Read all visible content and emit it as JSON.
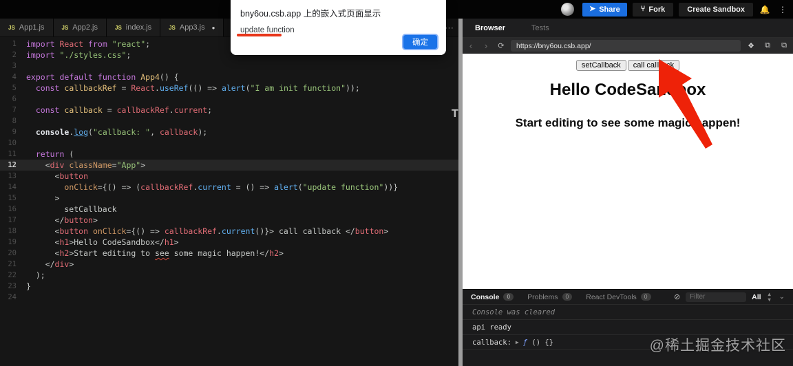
{
  "topbar": {
    "share_label": "Share",
    "fork_label": "Fork",
    "create_sandbox_label": "Create Sandbox"
  },
  "dialog": {
    "title": "bny6ou.csb.app 上的嵌入式页面显示",
    "message": "update function",
    "ok_label": "确定"
  },
  "editor": {
    "js_badge": "JS",
    "overflow_menu": "⋯",
    "tabs": [
      {
        "label": "App1.js",
        "dirty": false
      },
      {
        "label": "App2.js",
        "dirty": false
      },
      {
        "label": "index.js",
        "dirty": false
      },
      {
        "label": "App3.js",
        "dirty": true
      }
    ],
    "dirty_dot": "●",
    "lines": [
      {
        "n": 1,
        "hl": false,
        "tokens": [
          [
            "kw",
            "import"
          ],
          [
            "plain",
            " "
          ],
          [
            "ref",
            "React"
          ],
          [
            "plain",
            " "
          ],
          [
            "kw",
            "from"
          ],
          [
            "plain",
            " "
          ],
          [
            "str",
            "\"react\""
          ],
          [
            "plain",
            ";"
          ]
        ]
      },
      {
        "n": 2,
        "hl": false,
        "tokens": [
          [
            "kw",
            "import"
          ],
          [
            "plain",
            " "
          ],
          [
            "str",
            "\"./styles.css\""
          ],
          [
            "plain",
            ";"
          ]
        ]
      },
      {
        "n": 3,
        "hl": false,
        "tokens": []
      },
      {
        "n": 4,
        "hl": false,
        "tokens": [
          [
            "kw",
            "export"
          ],
          [
            "plain",
            " "
          ],
          [
            "kw",
            "default"
          ],
          [
            "plain",
            " "
          ],
          [
            "kw",
            "function"
          ],
          [
            "plain",
            " "
          ],
          [
            "def",
            "App4"
          ],
          [
            "plain",
            "() {"
          ]
        ]
      },
      {
        "n": 5,
        "hl": false,
        "tokens": [
          [
            "plain",
            "  "
          ],
          [
            "kw",
            "const"
          ],
          [
            "plain",
            " "
          ],
          [
            "def",
            "callbackRef"
          ],
          [
            "plain",
            " = "
          ],
          [
            "ref",
            "React"
          ],
          [
            "plain",
            "."
          ],
          [
            "fn",
            "useRef"
          ],
          [
            "plain",
            "(() => "
          ],
          [
            "fn",
            "alert"
          ],
          [
            "plain",
            "("
          ],
          [
            "str",
            "\"I am init function\""
          ],
          [
            "plain",
            "));"
          ]
        ]
      },
      {
        "n": 6,
        "hl": false,
        "tokens": []
      },
      {
        "n": 7,
        "hl": false,
        "tokens": [
          [
            "plain",
            "  "
          ],
          [
            "kw",
            "const"
          ],
          [
            "plain",
            " "
          ],
          [
            "def",
            "callback"
          ],
          [
            "plain",
            " = "
          ],
          [
            "ref",
            "callbackRef"
          ],
          [
            "plain",
            "."
          ],
          [
            "ref",
            "current"
          ],
          [
            "plain",
            ";"
          ]
        ]
      },
      {
        "n": 8,
        "hl": false,
        "tokens": []
      },
      {
        "n": 9,
        "hl": false,
        "tokens": [
          [
            "plain",
            "  "
          ],
          [
            "bold",
            "console"
          ],
          [
            "plain",
            "."
          ],
          [
            "fnu",
            "log"
          ],
          [
            "plain",
            "("
          ],
          [
            "str",
            "\"callback: \""
          ],
          [
            "plain",
            ", "
          ],
          [
            "ref",
            "callback"
          ],
          [
            "plain",
            ");"
          ]
        ]
      },
      {
        "n": 10,
        "hl": false,
        "tokens": []
      },
      {
        "n": 11,
        "hl": false,
        "tokens": [
          [
            "plain",
            "  "
          ],
          [
            "kw",
            "return"
          ],
          [
            "plain",
            " ("
          ]
        ]
      },
      {
        "n": 12,
        "hl": true,
        "tokens": [
          [
            "plain",
            "    <"
          ],
          [
            "tag",
            "div"
          ],
          [
            "plain",
            " "
          ],
          [
            "attr",
            "className"
          ],
          [
            "plain",
            "="
          ],
          [
            "str",
            "\"App\""
          ],
          [
            "plain",
            ">"
          ]
        ]
      },
      {
        "n": 13,
        "hl": false,
        "tokens": [
          [
            "plain",
            "      <"
          ],
          [
            "tag",
            "button"
          ]
        ]
      },
      {
        "n": 14,
        "hl": false,
        "tokens": [
          [
            "plain",
            "        "
          ],
          [
            "attr",
            "onClick"
          ],
          [
            "plain",
            "={() => ("
          ],
          [
            "ref",
            "callbackRef"
          ],
          [
            "plain",
            "."
          ],
          [
            "fn",
            "current"
          ],
          [
            "plain",
            " = () => "
          ],
          [
            "fn",
            "alert"
          ],
          [
            "plain",
            "("
          ],
          [
            "str",
            "\"update function\""
          ],
          [
            "plain",
            "))}"
          ]
        ]
      },
      {
        "n": 15,
        "hl": false,
        "tokens": [
          [
            "plain",
            "      >"
          ]
        ]
      },
      {
        "n": 16,
        "hl": false,
        "tokens": [
          [
            "plain",
            "        setCallback"
          ]
        ]
      },
      {
        "n": 17,
        "hl": false,
        "tokens": [
          [
            "plain",
            "      </"
          ],
          [
            "tag",
            "button"
          ],
          [
            "plain",
            ">"
          ]
        ]
      },
      {
        "n": 18,
        "hl": false,
        "tokens": [
          [
            "plain",
            "      <"
          ],
          [
            "tag",
            "button"
          ],
          [
            "plain",
            " "
          ],
          [
            "attr",
            "onClick"
          ],
          [
            "plain",
            "={() => "
          ],
          [
            "ref",
            "callbackRef"
          ],
          [
            "plain",
            "."
          ],
          [
            "fn",
            "current"
          ],
          [
            "plain",
            "()}> call callback </"
          ],
          [
            "tag",
            "button"
          ],
          [
            "plain",
            ">"
          ]
        ]
      },
      {
        "n": 19,
        "hl": false,
        "tokens": [
          [
            "plain",
            "      <"
          ],
          [
            "tag",
            "h1"
          ],
          [
            "plain",
            ">Hello CodeSandbox</"
          ],
          [
            "tag",
            "h1"
          ],
          [
            "plain",
            ">"
          ]
        ]
      },
      {
        "n": 20,
        "hl": false,
        "tokens": [
          [
            "plain",
            "      <"
          ],
          [
            "tag",
            "h2"
          ],
          [
            "plain",
            ">Start editing to "
          ],
          [
            "sq",
            "see"
          ],
          [
            "plain",
            " some magic happen!</"
          ],
          [
            "tag",
            "h2"
          ],
          [
            "plain",
            ">"
          ]
        ]
      },
      {
        "n": 21,
        "hl": false,
        "tokens": [
          [
            "plain",
            "    </"
          ],
          [
            "tag",
            "div"
          ],
          [
            "plain",
            ">"
          ]
        ]
      },
      {
        "n": 22,
        "hl": false,
        "tokens": [
          [
            "plain",
            "  );"
          ]
        ]
      },
      {
        "n": 23,
        "hl": false,
        "tokens": [
          [
            "plain",
            "}"
          ]
        ]
      },
      {
        "n": 24,
        "hl": false,
        "tokens": []
      }
    ],
    "t_handle": "T"
  },
  "browser": {
    "tab_browser": "Browser",
    "tab_tests": "Tests",
    "url": "https://bny6ou.csb.app/",
    "back_icon": "‹",
    "forward_icon": "›",
    "reload_icon": "⟳"
  },
  "preview": {
    "buttons": [
      {
        "label": "setCallback"
      },
      {
        "label": "call callback"
      }
    ],
    "h1": "Hello CodeSandbox",
    "h2": "Start editing to see some magic happen!",
    "arrow_color": "#ee2208"
  },
  "console": {
    "tabs": [
      {
        "label": "Console",
        "count": "0",
        "active": true
      },
      {
        "label": "Problems",
        "count": "0",
        "active": false
      },
      {
        "label": "React DevTools",
        "count": "0",
        "active": false
      }
    ],
    "filter_placeholder": "Filter",
    "level_select": "All",
    "rows": [
      {
        "type": "cleared",
        "text": "Console was cleared"
      },
      {
        "type": "log",
        "text": "api ready"
      },
      {
        "type": "fnlog",
        "label": "callback: ",
        "expander": "▶",
        "fn": "ƒ",
        "rest": " () {}"
      }
    ]
  },
  "watermark": "@稀土掘金技术社区"
}
